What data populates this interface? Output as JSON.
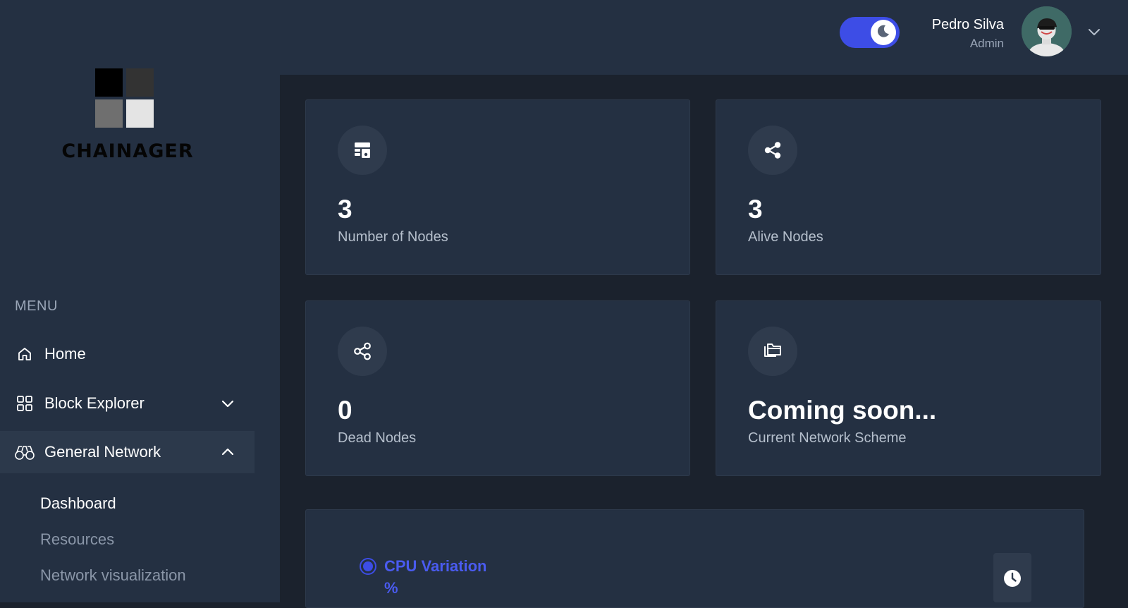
{
  "app": {
    "logo_text": "CHAINAGER"
  },
  "header": {
    "theme_toggle": "dark",
    "user": {
      "name": "Pedro Silva",
      "role": "Admin"
    }
  },
  "sidebar": {
    "menu_heading": "MENU",
    "items": [
      {
        "label": "Home",
        "icon": "home-icon"
      },
      {
        "label": "Block Explorer",
        "icon": "grid-icon",
        "expanded": false
      },
      {
        "label": "General Network",
        "icon": "binoculars-icon",
        "expanded": true
      }
    ],
    "sub_items": [
      {
        "label": "Dashboard",
        "active": true
      },
      {
        "label": "Resources",
        "active": false
      },
      {
        "label": "Network visualization",
        "active": false
      }
    ]
  },
  "cards": [
    {
      "value": "3",
      "label": "Number of Nodes",
      "icon": "server-icon"
    },
    {
      "value": "3",
      "label": "Alive Nodes",
      "icon": "share-icon"
    },
    {
      "value": "0",
      "label": "Dead Nodes",
      "icon": "share-outline-icon"
    },
    {
      "value": "Coming soon...",
      "label": "Current Network Scheme",
      "icon": "folders-icon"
    }
  ],
  "chart_panel": {
    "option_label": "CPU Variation",
    "option_unit": "%",
    "button_icon": "clock-icon"
  },
  "colors": {
    "accent": "#3d4de6",
    "sidebar_bg": "#243042",
    "main_bg": "#1b222d",
    "card_bg": "#243042"
  }
}
